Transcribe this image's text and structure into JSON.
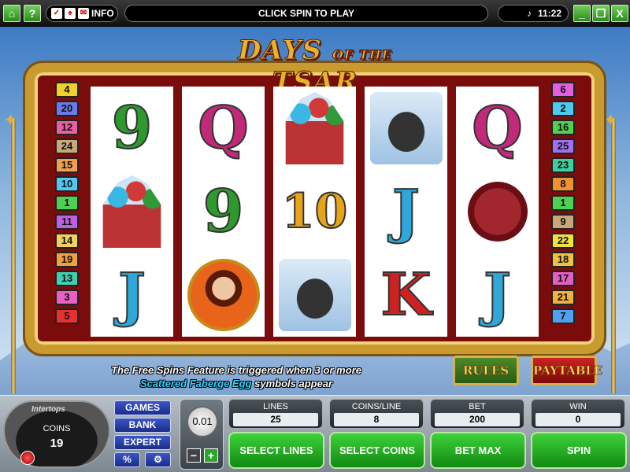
{
  "topbar": {
    "message": "CLICK SPIN TO PLAY",
    "info_label": "INFO",
    "time": "11:22",
    "home_icon": "home-icon",
    "help_label": "?",
    "minimize_label": "_",
    "restore_icon": "restore-icon",
    "close_label": "X"
  },
  "game": {
    "logo_main": "DAYS",
    "logo_of": "OF THE",
    "logo_tsar": "TSAR",
    "reels": [
      [
        "9",
        "cathedral",
        "J"
      ],
      [
        "Q",
        "9",
        "tsarina"
      ],
      [
        "cathedral",
        "10",
        "horseman"
      ],
      [
        "horseman",
        "J",
        "K"
      ],
      [
        "Q",
        "seal",
        "J"
      ]
    ],
    "left_lines": [
      {
        "n": "4",
        "color": "#f0d02a"
      },
      {
        "n": "20",
        "color": "#6a7ae8"
      },
      {
        "n": "12",
        "color": "#e860a0"
      },
      {
        "n": "24",
        "color": "#c8a878"
      },
      {
        "n": "15",
        "color": "#f0a050"
      },
      {
        "n": "10",
        "color": "#50c8f0"
      },
      {
        "n": "1",
        "color": "#50d050"
      },
      {
        "n": "11",
        "color": "#c060e0"
      },
      {
        "n": "14",
        "color": "#f0d060"
      },
      {
        "n": "19",
        "color": "#f0a040"
      },
      {
        "n": "13",
        "color": "#40d0b0"
      },
      {
        "n": "3",
        "color": "#e860c0"
      },
      {
        "n": "5",
        "color": "#e83030"
      }
    ],
    "right_lines": [
      {
        "n": "6",
        "color": "#e060e0"
      },
      {
        "n": "2",
        "color": "#50c8f0"
      },
      {
        "n": "16",
        "color": "#50d050"
      },
      {
        "n": "25",
        "color": "#a070f0"
      },
      {
        "n": "23",
        "color": "#40d0a0"
      },
      {
        "n": "8",
        "color": "#f09030"
      },
      {
        "n": "1",
        "color": "#50d050"
      },
      {
        "n": "9",
        "color": "#c8a878"
      },
      {
        "n": "22",
        "color": "#f0e040"
      },
      {
        "n": "18",
        "color": "#f0c040"
      },
      {
        "n": "17",
        "color": "#e060c0"
      },
      {
        "n": "21",
        "color": "#f0b040"
      },
      {
        "n": "7",
        "color": "#50a0f0"
      }
    ],
    "notice_line1": "The Free Spins Feature is triggered when 3 or more",
    "notice_highlight": "Scattered Faberge Egg",
    "notice_line2_rest": "symbols appear",
    "rules_label": "RULES",
    "paytable_label": "PAYTABLE"
  },
  "panel": {
    "brand": "Intertops",
    "coins_label": "COINS",
    "coins_value": "19",
    "games_label": "GAMES",
    "bank_label": "BANK",
    "expert_label": "EXPERT",
    "percent_label": "%",
    "settings_icon": "gear-icon",
    "coin_value": "0.01",
    "lines_label": "LINES",
    "lines_value": "25",
    "coinsline_label": "COINS/LINE",
    "coinsline_value": "8",
    "bet_label": "BET",
    "bet_value": "200",
    "win_label": "WIN",
    "win_value": "0",
    "select_lines": "SELECT LINES",
    "select_coins": "SELECT COINS",
    "bet_max": "BET MAX",
    "spin": "SPIN"
  }
}
